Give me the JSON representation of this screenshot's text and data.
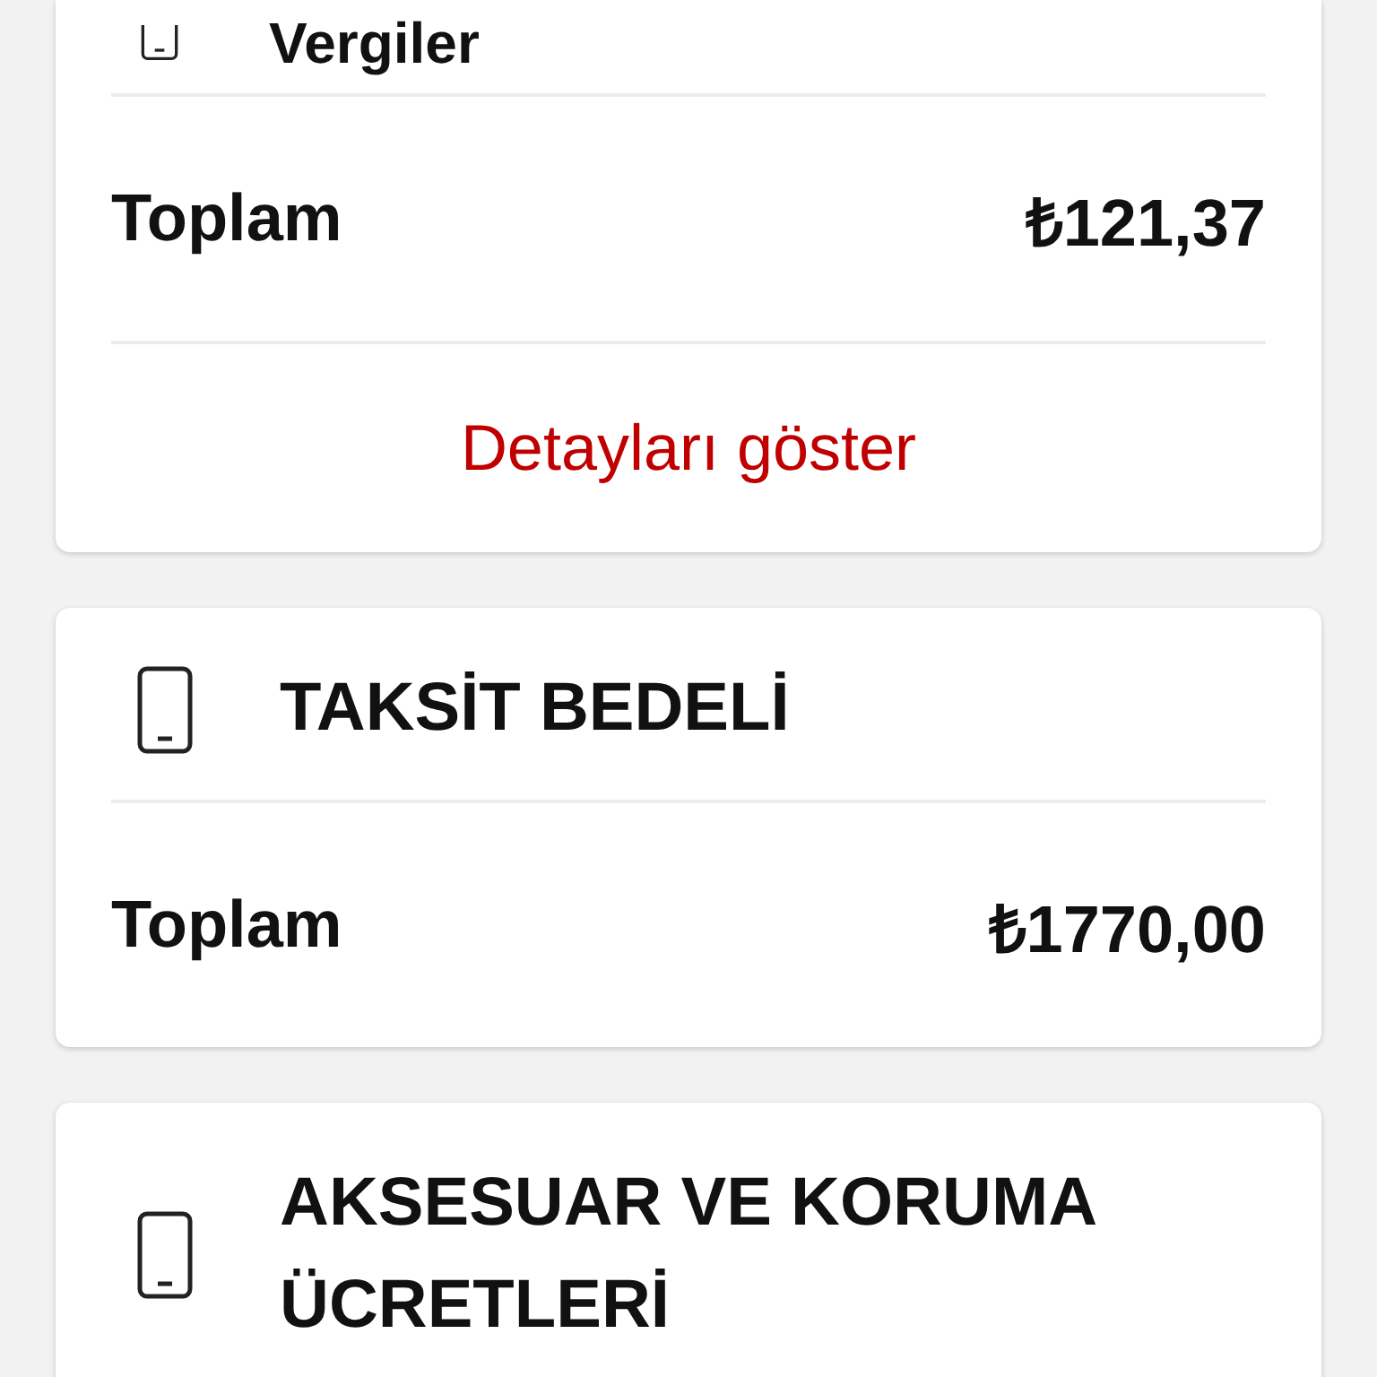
{
  "cards": [
    {
      "title": "Vergiler",
      "total_label": "Toplam",
      "total_value": "₺121,37",
      "link": "Detayları göster"
    },
    {
      "title": "TAKSİT BEDELİ",
      "total_label": "Toplam",
      "total_value": "₺1770,00"
    },
    {
      "title": "AKSESUAR VE KORUMA ÜCRETLERİ"
    }
  ]
}
